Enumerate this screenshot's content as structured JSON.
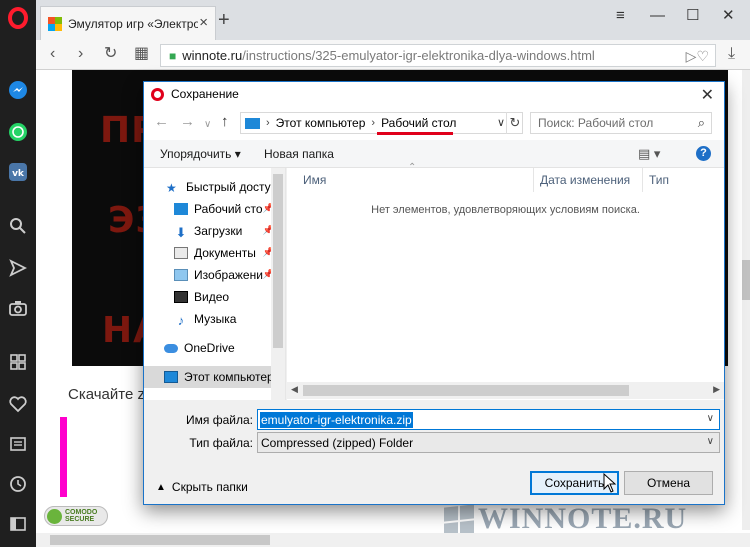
{
  "browser": {
    "tab_title": "Эмулятор игр «Электрон",
    "new_tab_symbol": "+",
    "url_domain": "winnote.ru",
    "url_path": "/instructions/325-emulyator-igr-elektronika-dlya-windows.html",
    "icons": [
      "opera-logo-icon",
      "messenger-icon",
      "whatsapp-icon",
      "vk-icon",
      "search-icon",
      "send-icon",
      "camera-icon",
      "apps-icon",
      "heart-icon",
      "news-icon",
      "history-icon",
      "sidebar-toggle-icon"
    ]
  },
  "page": {
    "video_words": [
      "ПРО",
      "ЭЗ",
      "НА"
    ],
    "download_text": "Скачайте z",
    "comodo_line1": "COMODO",
    "comodo_line2": "SECURE",
    "watermark": "WINNOTE.RU"
  },
  "dialog": {
    "title": "Сохранение",
    "breadcrumb": [
      "Этот компьютер",
      "Рабочий стол"
    ],
    "search_placeholder": "Поиск: Рабочий стол",
    "toolbar": {
      "organize": "Упорядочить",
      "new_folder": "Новая папка"
    },
    "nav_items": [
      {
        "label": "Быстрый доступ",
        "pinned": false
      },
      {
        "label": "Рабочий сто",
        "pinned": true
      },
      {
        "label": "Загрузки",
        "pinned": true
      },
      {
        "label": "Документы",
        "pinned": true
      },
      {
        "label": "Изображени",
        "pinned": true
      },
      {
        "label": "Видео",
        "pinned": false
      },
      {
        "label": "Музыка",
        "pinned": false
      },
      {
        "label": "OneDrive",
        "pinned": false
      },
      {
        "label": "Этот компьютер",
        "pinned": false
      }
    ],
    "columns": [
      "Имя",
      "Дата изменения",
      "Тип"
    ],
    "empty_message": "Нет элементов, удовлетворяющих условиям поиска.",
    "filename_label": "Имя файла:",
    "filename_value": "emulyator-igr-elektronika.zip",
    "filetype_label": "Тип файла:",
    "filetype_value": "Compressed (zipped) Folder",
    "hide_folders": "Скрыть папки",
    "save_button": "Сохранить",
    "cancel_button": "Отмена",
    "help_symbol": "?"
  },
  "colors": {
    "accent": "#0078d7",
    "opera_red": "#e0001b",
    "underline": "#e0001b",
    "magenta": "#ff00cc"
  }
}
